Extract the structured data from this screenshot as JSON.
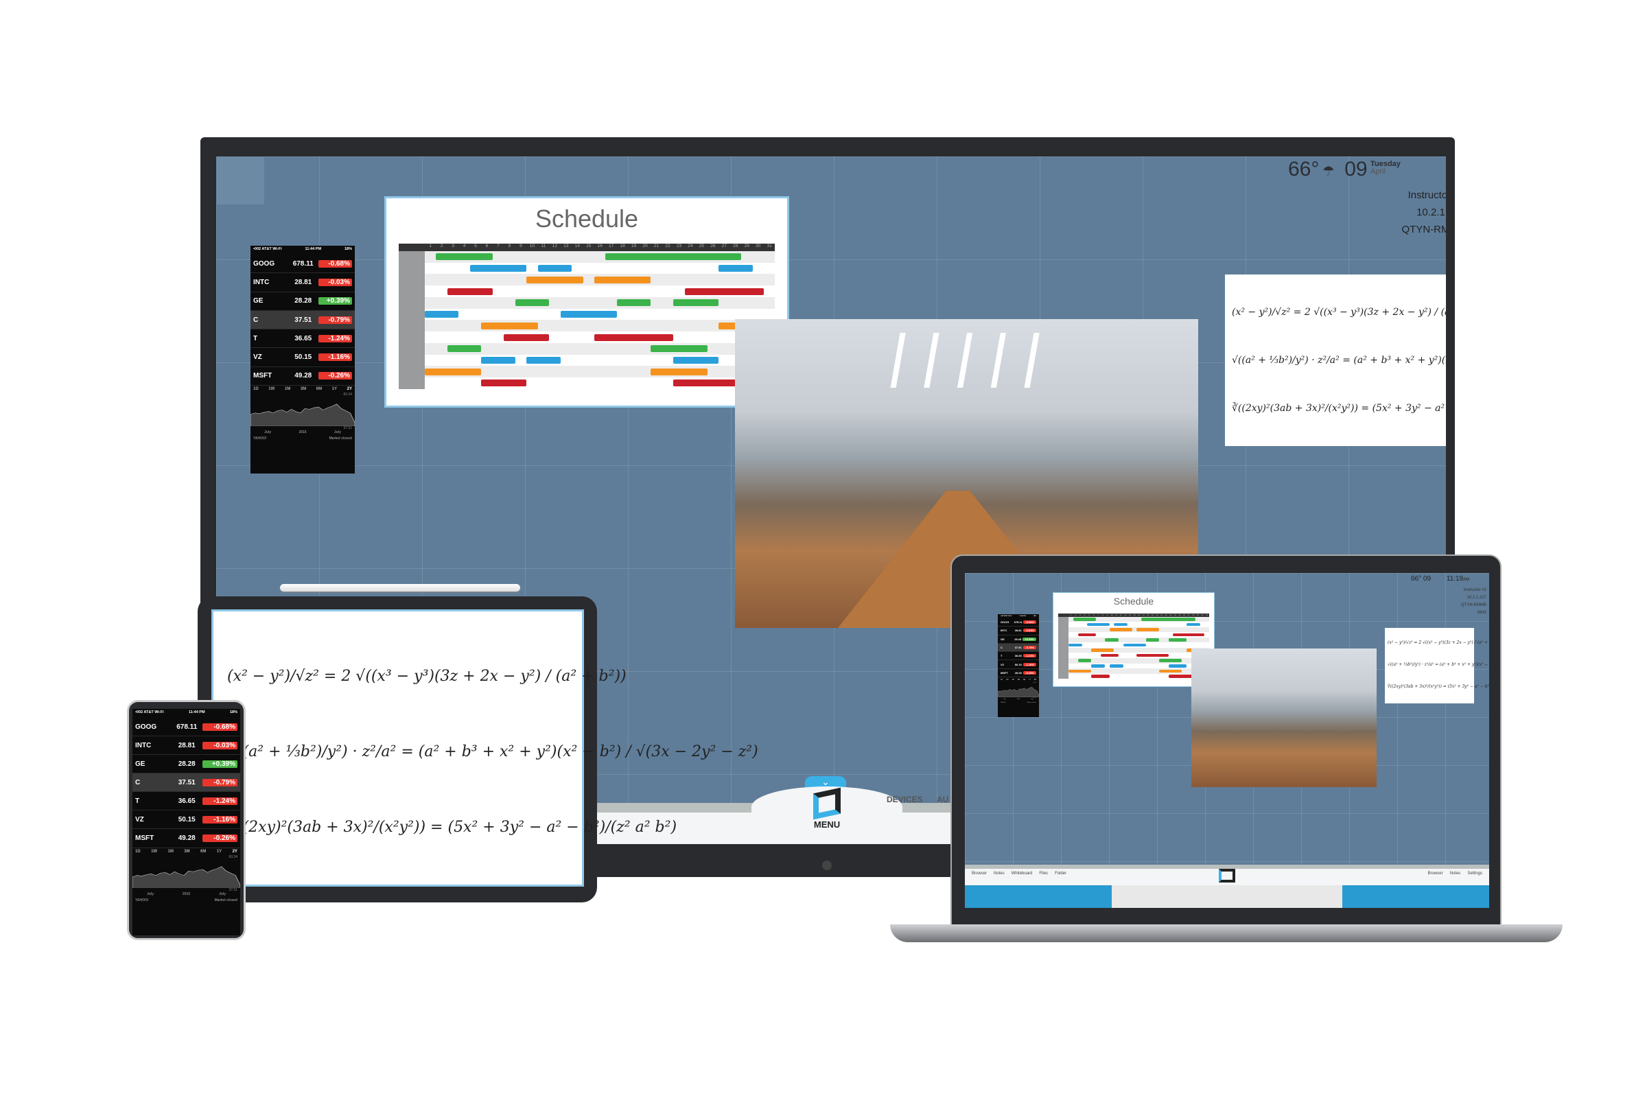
{
  "display": {
    "weather": {
      "temp": "66°",
      "icon": "rain-cloud-icon"
    },
    "date": {
      "day": "09",
      "weekday": "Tuesday",
      "month": "April"
    },
    "time": "11:19",
    "time_suffix": "AM",
    "info": [
      "Instructor #2",
      "10.2.1.217",
      "QTYN-RMMB",
      "5843"
    ],
    "menu": {
      "label": "MENU",
      "tabs": [
        "DEVICES",
        "AU"
      ]
    }
  },
  "stocks": {
    "status": {
      "carrier": "•002 AT&T Wi-Fi",
      "time": "11:44 PM",
      "battery": "18%"
    },
    "rows": [
      {
        "symbol": "GOOG",
        "price": "678.11",
        "change": "-0.68%",
        "up": false
      },
      {
        "symbol": "INTC",
        "price": "28.81",
        "change": "-0.03%",
        "up": false
      },
      {
        "symbol": "GE",
        "price": "28.28",
        "change": "+0.39%",
        "up": true
      },
      {
        "symbol": "C",
        "price": "37.51",
        "change": "-0.79%",
        "up": false,
        "selected": true
      },
      {
        "symbol": "T",
        "price": "36.65",
        "change": "-1.24%",
        "up": false
      },
      {
        "symbol": "VZ",
        "price": "50.15",
        "change": "-1.16%",
        "up": false
      },
      {
        "symbol": "MSFT",
        "price": "49.28",
        "change": "-0.26%",
        "up": false
      }
    ],
    "ranges": [
      "1D",
      "1W",
      "1M",
      "3M",
      "6M",
      "1Y",
      "2Y"
    ],
    "active_range": "2Y",
    "chart_high": "60.34",
    "chart_low": "37.51",
    "chart_labels": [
      "July",
      "2015",
      "July"
    ],
    "footer": {
      "brand": "YAHOO!",
      "status": "Market closed"
    },
    "colors": {
      "down": "#e8362d",
      "up": "#4cb648"
    }
  },
  "schedule": {
    "title": "Schedule",
    "days": [
      "1",
      "2",
      "3",
      "4",
      "5",
      "6",
      "7",
      "8",
      "9",
      "10",
      "11",
      "12",
      "13",
      "14",
      "15",
      "16",
      "17",
      "18",
      "19",
      "20",
      "21",
      "22",
      "23",
      "24",
      "25",
      "26",
      "27",
      "28",
      "29",
      "30",
      "31"
    ],
    "colors": {
      "green": "#3bb34a",
      "blue": "#2b9fdc",
      "orange": "#f5921e",
      "red": "#c8202a"
    },
    "rows": [
      [
        [
          2,
          6,
          "green"
        ],
        [
          17,
          28,
          "green"
        ]
      ],
      [
        [
          5,
          9,
          "blue"
        ],
        [
          11,
          13,
          "blue"
        ],
        [
          27,
          29,
          "blue"
        ]
      ],
      [
        [
          10,
          14,
          "orange"
        ],
        [
          16,
          20,
          "orange"
        ]
      ],
      [
        [
          3,
          6,
          "red"
        ],
        [
          24,
          30,
          "red"
        ]
      ],
      [
        [
          9,
          11,
          "green"
        ],
        [
          18,
          20,
          "green"
        ],
        [
          23,
          26,
          "green"
        ]
      ],
      [
        [
          1,
          3,
          "blue"
        ],
        [
          13,
          17,
          "blue"
        ]
      ],
      [
        [
          6,
          10,
          "orange"
        ],
        [
          27,
          31,
          "orange"
        ]
      ],
      [
        [
          8,
          11,
          "red"
        ],
        [
          16,
          22,
          "red"
        ]
      ],
      [
        [
          3,
          5,
          "green"
        ],
        [
          21,
          25,
          "green"
        ]
      ],
      [
        [
          6,
          8,
          "blue"
        ],
        [
          10,
          12,
          "blue"
        ],
        [
          23,
          26,
          "blue"
        ]
      ],
      [
        [
          1,
          5,
          "orange"
        ],
        [
          21,
          25,
          "orange"
        ]
      ],
      [
        [
          6,
          9,
          "red"
        ],
        [
          23,
          28,
          "red"
        ]
      ]
    ]
  },
  "math": [
    "(x² − y²)/√z² = 2 √((x³ − y³)(3z + 2x − y²) / (a² + b²))",
    "√((a² + ⅓b²)/y²) · z²/a² = (a² + b³ + x² + y²)(x² − b²) / √(3x − 2y² − z²)",
    "∛((2xy)²(3ab + 3x)²/(x²y²)) = (5x² + 3y² − a² − b²)/(z² a² b²)"
  ],
  "laptop": {
    "dock_left": [
      "Browser",
      "Notes",
      "Whiteboard",
      "Files",
      "Folder"
    ],
    "dock_right": [
      "Browser",
      "Notes",
      "Settings"
    ]
  }
}
